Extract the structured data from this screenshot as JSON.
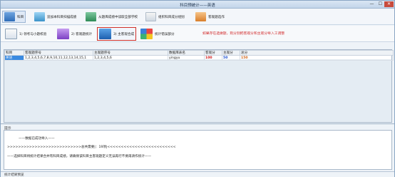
{
  "window": {
    "title": "科目预统计——英语",
    "min": "—",
    "max": "☐",
    "close": "✕"
  },
  "toolbar": [
    {
      "label": "科目",
      "icon": "grid-icon"
    },
    {
      "label": "追加本科目扫描成绩",
      "icon": "plus-doc-icon"
    },
    {
      "label": "从题库成绩中读取全部学校",
      "icon": "tree-icon"
    },
    {
      "label": "组织科目成分组别",
      "icon": "window-icon"
    },
    {
      "label": "客观题选作",
      "icon": "person-icon"
    }
  ],
  "toolbar2": [
    {
      "label": "1) 领考与小题校验",
      "icon": "calendar-icon"
    },
    {
      "label": "2) 客观题统计",
      "icon": "monitor-icon"
    },
    {
      "label": "3) 主客观合成",
      "icon": "merge-icon"
    },
    {
      "label": "统计错误部分",
      "icon": "colors-icon"
    }
  ],
  "note": "如果存在选做题，则分别把客观分和主观分导入工调整",
  "grid": {
    "headers": [
      "科目",
      "客观题序号",
      "主观题序号",
      "数据库表名",
      "客观分",
      "主观分",
      "总分"
    ],
    "rows": [
      {
        "subject": "英语",
        "objective": "1,2,3,4,5,6,7,8,9,10,11,12,13,14,15,1",
        "subjective": "1,2,3,4,5,6",
        "table": "yingyu",
        "obj_score": "100",
        "sub_score": "50",
        "total": "150"
      }
    ]
  },
  "log": {
    "label": "提示",
    "lines": [
      "——数据已成功导入——",
      ">>>>>>>>>>>>>>>>>>>>>>>>>>>总共需要|：19项|<<<<<<<<<<<<<<<<<<<<<<<<<",
      "——选择科目将统计结果合并有科目成绩，请确保该科目主客观题定义无误再行不要再请作统计——"
    ]
  },
  "status": "统计结果预览"
}
